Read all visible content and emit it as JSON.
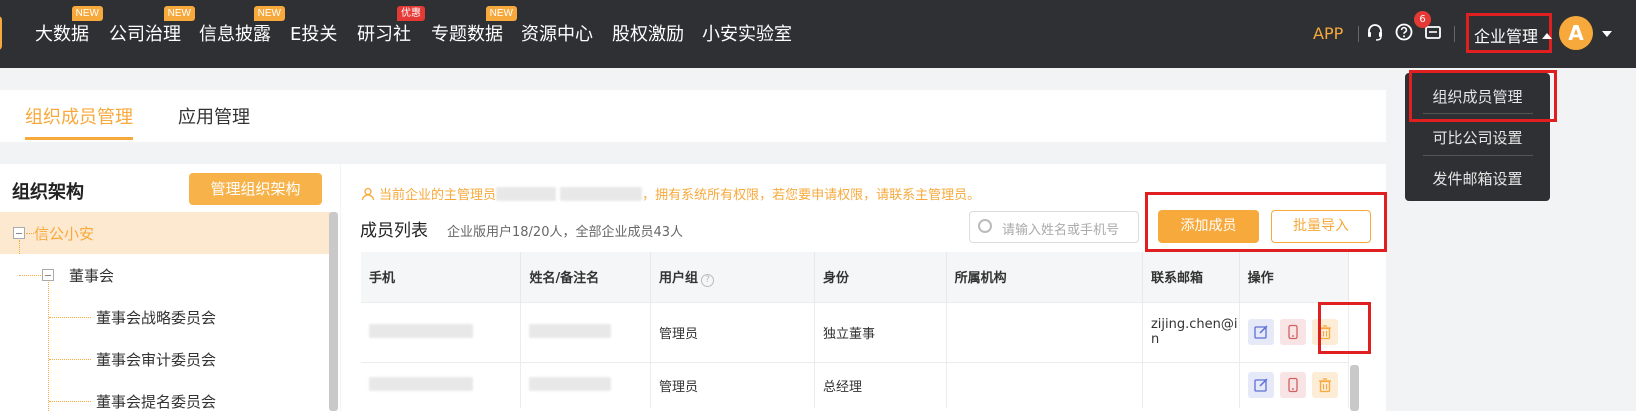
{
  "nav": {
    "items": [
      {
        "label": "大数据",
        "badge": "NEW"
      },
      {
        "label": "公司治理",
        "badge": "NEW"
      },
      {
        "label": "信息披露",
        "badge": "NEW"
      },
      {
        "label": "E投关",
        "badge": ""
      },
      {
        "label": "研习社",
        "badge": "优惠"
      },
      {
        "label": "专题数据",
        "badge": "NEW"
      },
      {
        "label": "资源中心",
        "badge": ""
      },
      {
        "label": "股权激励",
        "badge": ""
      },
      {
        "label": "小安实验室",
        "badge": ""
      }
    ],
    "app_label": "APP",
    "notification_count": "6",
    "enterprise_label": "企业管理",
    "avatar_letter": "A",
    "icons": [
      "headset-icon",
      "help-icon",
      "message-icon"
    ]
  },
  "dropdown": {
    "items": [
      "组织成员管理",
      "可比公司设置",
      "发件邮箱设置"
    ]
  },
  "tabs": [
    "组织成员管理",
    "应用管理"
  ],
  "org": {
    "title": "组织架构",
    "manage_button": "管理组织架构",
    "tree": [
      {
        "label": "信公小安",
        "selected": true
      },
      {
        "label": "董事会",
        "selected": false
      },
      {
        "label": "董事会战略委员会",
        "selected": false
      },
      {
        "label": "董事会审计委员会",
        "selected": false
      },
      {
        "label": "董事会提名委员会",
        "selected": false
      }
    ]
  },
  "members": {
    "notice_prefix": "当前企业的主管理员",
    "notice_suffix": "，拥有系统所有权限，若您要申请权限，请联系主管理员。",
    "title": "成员列表",
    "subtitle": "企业版用户18/20人，全部企业成员43人",
    "search_placeholder": "请输入姓名或手机号",
    "add_button": "添加成员",
    "import_button": "批量导入",
    "columns": [
      "手机",
      "姓名/备注名",
      "用户组",
      "身份",
      "所属机构",
      "联系邮箱",
      "操作"
    ],
    "rows": [
      {
        "group": "管理员",
        "identity": "独立董事",
        "org": "",
        "email_line1": "zijing.chen@i",
        "email_line2": "n"
      },
      {
        "group": "管理员",
        "identity": "总经理",
        "org": "",
        "email_line1": "",
        "email_line2": ""
      }
    ]
  },
  "colors": {
    "accent": "#f7a93c",
    "nav_bg": "#2f3033",
    "highlight": "#e02020"
  }
}
